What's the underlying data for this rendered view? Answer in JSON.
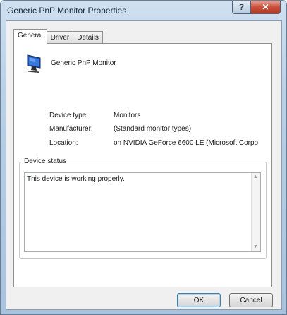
{
  "window": {
    "title": "Generic PnP Monitor Properties",
    "help_label": "?",
    "close_label": "✕"
  },
  "tabs": [
    {
      "label": "General",
      "active": true
    },
    {
      "label": "Driver",
      "active": false
    },
    {
      "label": "Details",
      "active": false
    }
  ],
  "device": {
    "name": "Generic PnP Monitor",
    "icon": "monitor-icon"
  },
  "properties": [
    {
      "label": "Device type:",
      "value": "Monitors"
    },
    {
      "label": "Manufacturer:",
      "value": "(Standard monitor types)"
    },
    {
      "label": "Location:",
      "value": "on NVIDIA GeForce 6600 LE (Microsoft Corpo"
    }
  ],
  "status": {
    "caption": "Device status",
    "text": "This device is working properly."
  },
  "buttons": {
    "ok_label": "OK",
    "cancel_label": "Cancel"
  },
  "colors": {
    "close_button": "#c9503b",
    "title_frame": "#b9d0e6",
    "default_button_border": "#3c7fb1"
  }
}
